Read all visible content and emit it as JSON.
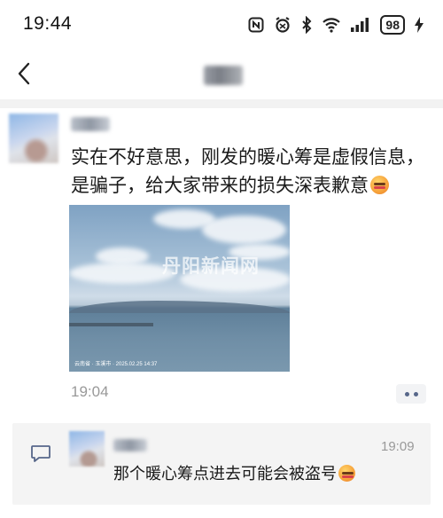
{
  "status_bar": {
    "time": "19:44",
    "battery": "98",
    "icons": [
      "nfc-icon",
      "alarm-icon",
      "bluetooth-icon",
      "wifi-icon",
      "signal-icon",
      "battery-icon",
      "charging-icon"
    ]
  },
  "nav": {
    "back_icon": "back-arrow-icon",
    "title": ""
  },
  "post": {
    "text": "实在不好意思，刚发的暖心筹是虚假信息，是骗子，给大家带来的损失深表歉意",
    "emoji": "sad-face-emoji",
    "photo": {
      "watermark": "丹阳新闻网",
      "caption": "云南省 · 玉溪市 · 2025.02.25 14:37"
    },
    "time": "19:04",
    "more_icon": "more-dots-icon"
  },
  "comment": {
    "icon": "comment-icon",
    "time": "19:09",
    "text": "那个暖心筹点进去可能会被盗号",
    "emoji": "sad-face-emoji"
  },
  "colors": {
    "background": "#ffffff",
    "divider": "#f2f2f2",
    "comment_bg": "#f4f4f4",
    "more_dots": "#57678a",
    "meta_text": "#999999"
  }
}
